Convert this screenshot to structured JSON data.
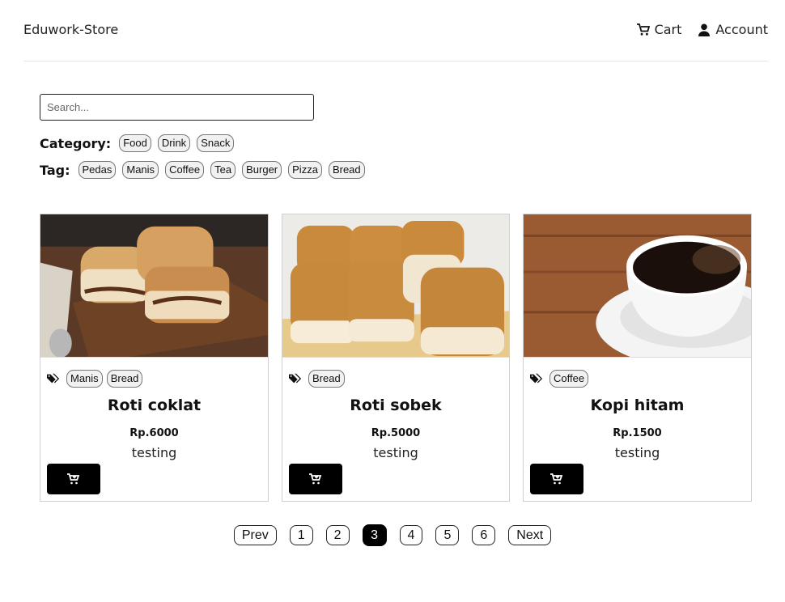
{
  "navbar": {
    "brand": "Eduwork-Store",
    "cart_label": "Cart",
    "account_label": "Account"
  },
  "search": {
    "placeholder": "Search..."
  },
  "filters": {
    "category_label": "Category:",
    "categories": [
      "Food",
      "Drink",
      "Snack"
    ],
    "tag_label": "Tag:",
    "tags": [
      "Pedas",
      "Manis",
      "Coffee",
      "Tea",
      "Burger",
      "Pizza",
      "Bread"
    ]
  },
  "products": [
    {
      "title": "Roti coklat",
      "price": "Rp.6000",
      "description": "testing",
      "tags": [
        "Manis",
        "Bread"
      ],
      "image": "chocolate-bread-photo"
    },
    {
      "title": "Roti sobek",
      "price": "Rp.5000",
      "description": "testing",
      "tags": [
        "Bread"
      ],
      "image": "pull-apart-bread-photo"
    },
    {
      "title": "Kopi hitam",
      "price": "Rp.1500",
      "description": "testing",
      "tags": [
        "Coffee"
      ],
      "image": "black-coffee-photo"
    }
  ],
  "pagination": {
    "prev_label": "Prev",
    "next_label": "Next",
    "pages": [
      "1",
      "2",
      "3",
      "4",
      "5",
      "6"
    ],
    "current_page": "3"
  },
  "icons": {
    "cart": "cart-icon",
    "account": "user-icon",
    "tag": "tags-icon",
    "add_to_cart": "cart-plus-icon"
  },
  "colors": {
    "button_bg": "#000000",
    "chip_bg": "#f1f1f1",
    "active_page_bg": "#000000"
  }
}
